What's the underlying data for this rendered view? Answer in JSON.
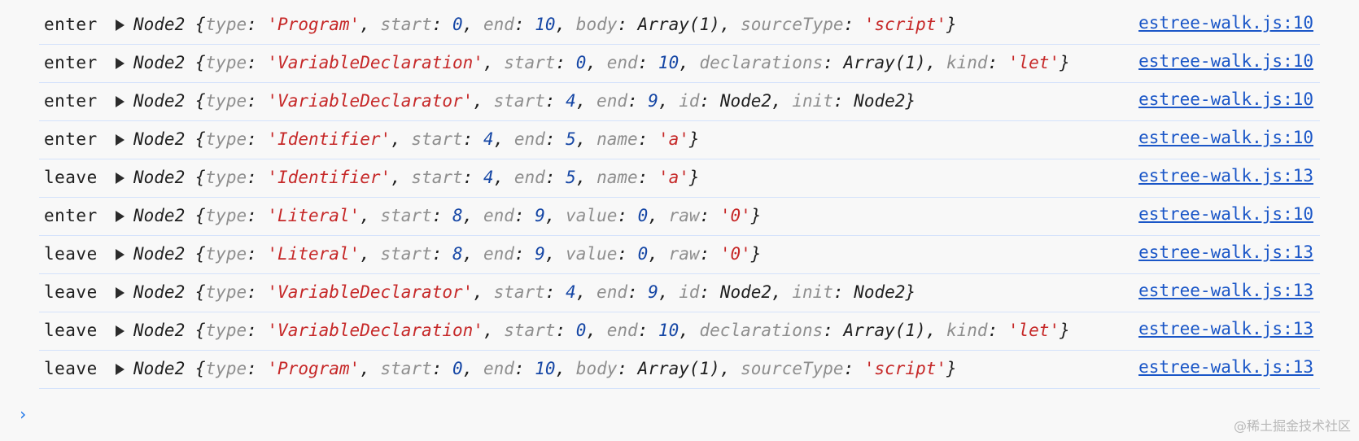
{
  "console": {
    "rows": [
      {
        "prefix": "enter",
        "class_name": "Node2",
        "open_brace": "{",
        "close_brace": "}",
        "props": [
          {
            "key": "type",
            "sep": ": ",
            "value": "'Program'",
            "value_kind": "string"
          },
          {
            "key": "start",
            "sep": ": ",
            "value": "0",
            "value_kind": "number"
          },
          {
            "key": "end",
            "sep": ": ",
            "value": "10",
            "value_kind": "number"
          },
          {
            "key": "body",
            "sep": ": ",
            "value": "Array(1)",
            "value_kind": "plain"
          },
          {
            "key": "sourceType",
            "sep": ": ",
            "value": "'script'",
            "value_kind": "string"
          }
        ],
        "source": "estree-walk.js:10"
      },
      {
        "prefix": "enter",
        "class_name": "Node2",
        "open_brace": "{",
        "close_brace": "}",
        "props": [
          {
            "key": "type",
            "sep": ": ",
            "value": "'VariableDeclaration'",
            "value_kind": "string"
          },
          {
            "key": "start",
            "sep": ": ",
            "value": "0",
            "value_kind": "number"
          },
          {
            "key": "end",
            "sep": ": ",
            "value": "10",
            "value_kind": "number"
          },
          {
            "key": "declarations",
            "sep": ": ",
            "value": "Array(1)",
            "value_kind": "plain"
          },
          {
            "key": "kind",
            "sep": ": ",
            "value": "'let'",
            "value_kind": "string"
          }
        ],
        "source": "estree-walk.js:10"
      },
      {
        "prefix": "enter",
        "class_name": "Node2",
        "open_brace": "{",
        "close_brace": "}",
        "props": [
          {
            "key": "type",
            "sep": ": ",
            "value": "'VariableDeclarator'",
            "value_kind": "string"
          },
          {
            "key": "start",
            "sep": ": ",
            "value": "4",
            "value_kind": "number"
          },
          {
            "key": "end",
            "sep": ": ",
            "value": "9",
            "value_kind": "number"
          },
          {
            "key": "id",
            "sep": ": ",
            "value": "Node2",
            "value_kind": "plain"
          },
          {
            "key": "init",
            "sep": ": ",
            "value": "Node2",
            "value_kind": "plain"
          }
        ],
        "source": "estree-walk.js:10"
      },
      {
        "prefix": "enter",
        "class_name": "Node2",
        "open_brace": "{",
        "close_brace": "}",
        "props": [
          {
            "key": "type",
            "sep": ": ",
            "value": "'Identifier'",
            "value_kind": "string"
          },
          {
            "key": "start",
            "sep": ": ",
            "value": "4",
            "value_kind": "number"
          },
          {
            "key": "end",
            "sep": ": ",
            "value": "5",
            "value_kind": "number"
          },
          {
            "key": "name",
            "sep": ": ",
            "value": "'a'",
            "value_kind": "string"
          }
        ],
        "source": "estree-walk.js:10"
      },
      {
        "prefix": "leave",
        "class_name": "Node2",
        "open_brace": "{",
        "close_brace": "}",
        "props": [
          {
            "key": "type",
            "sep": ": ",
            "value": "'Identifier'",
            "value_kind": "string"
          },
          {
            "key": "start",
            "sep": ": ",
            "value": "4",
            "value_kind": "number"
          },
          {
            "key": "end",
            "sep": ": ",
            "value": "5",
            "value_kind": "number"
          },
          {
            "key": "name",
            "sep": ": ",
            "value": "'a'",
            "value_kind": "string"
          }
        ],
        "source": "estree-walk.js:13"
      },
      {
        "prefix": "enter",
        "class_name": "Node2",
        "open_brace": "{",
        "close_brace": "}",
        "props": [
          {
            "key": "type",
            "sep": ": ",
            "value": "'Literal'",
            "value_kind": "string"
          },
          {
            "key": "start",
            "sep": ": ",
            "value": "8",
            "value_kind": "number"
          },
          {
            "key": "end",
            "sep": ": ",
            "value": "9",
            "value_kind": "number"
          },
          {
            "key": "value",
            "sep": ": ",
            "value": "0",
            "value_kind": "number"
          },
          {
            "key": "raw",
            "sep": ": ",
            "value": "'0'",
            "value_kind": "string"
          }
        ],
        "source": "estree-walk.js:10"
      },
      {
        "prefix": "leave",
        "class_name": "Node2",
        "open_brace": "{",
        "close_brace": "}",
        "props": [
          {
            "key": "type",
            "sep": ": ",
            "value": "'Literal'",
            "value_kind": "string"
          },
          {
            "key": "start",
            "sep": ": ",
            "value": "8",
            "value_kind": "number"
          },
          {
            "key": "end",
            "sep": ": ",
            "value": "9",
            "value_kind": "number"
          },
          {
            "key": "value",
            "sep": ": ",
            "value": "0",
            "value_kind": "number"
          },
          {
            "key": "raw",
            "sep": ": ",
            "value": "'0'",
            "value_kind": "string"
          }
        ],
        "source": "estree-walk.js:13"
      },
      {
        "prefix": "leave",
        "class_name": "Node2",
        "open_brace": "{",
        "close_brace": "}",
        "props": [
          {
            "key": "type",
            "sep": ": ",
            "value": "'VariableDeclarator'",
            "value_kind": "string"
          },
          {
            "key": "start",
            "sep": ": ",
            "value": "4",
            "value_kind": "number"
          },
          {
            "key": "end",
            "sep": ": ",
            "value": "9",
            "value_kind": "number"
          },
          {
            "key": "id",
            "sep": ": ",
            "value": "Node2",
            "value_kind": "plain"
          },
          {
            "key": "init",
            "sep": ": ",
            "value": "Node2",
            "value_kind": "plain"
          }
        ],
        "source": "estree-walk.js:13"
      },
      {
        "prefix": "leave",
        "class_name": "Node2",
        "open_brace": "{",
        "close_brace": "}",
        "props": [
          {
            "key": "type",
            "sep": ": ",
            "value": "'VariableDeclaration'",
            "value_kind": "string"
          },
          {
            "key": "start",
            "sep": ": ",
            "value": "0",
            "value_kind": "number"
          },
          {
            "key": "end",
            "sep": ": ",
            "value": "10",
            "value_kind": "number"
          },
          {
            "key": "declarations",
            "sep": ": ",
            "value": "Array(1)",
            "value_kind": "plain"
          },
          {
            "key": "kind",
            "sep": ": ",
            "value": "'let'",
            "value_kind": "string"
          }
        ],
        "source": "estree-walk.js:13"
      },
      {
        "prefix": "leave",
        "class_name": "Node2",
        "open_brace": "{",
        "close_brace": "}",
        "props": [
          {
            "key": "type",
            "sep": ": ",
            "value": "'Program'",
            "value_kind": "string"
          },
          {
            "key": "start",
            "sep": ": ",
            "value": "0",
            "value_kind": "number"
          },
          {
            "key": "end",
            "sep": ": ",
            "value": "10",
            "value_kind": "number"
          },
          {
            "key": "body",
            "sep": ": ",
            "value": "Array(1)",
            "value_kind": "plain"
          },
          {
            "key": "sourceType",
            "sep": ": ",
            "value": "'script'",
            "value_kind": "string"
          }
        ],
        "source": "estree-walk.js:13"
      }
    ],
    "prompt_icon": "chevron-right-icon",
    "prompt_glyph": "›"
  },
  "watermark": {
    "text": "@稀土掘金技术社区"
  },
  "colors": {
    "background": "#f8f8f8",
    "key": "#8e8e8e",
    "string": "#c62828",
    "number": "#1546a5",
    "link": "#1a56c7",
    "row_border": "#d4e2fb",
    "prompt": "#1a73e8"
  }
}
